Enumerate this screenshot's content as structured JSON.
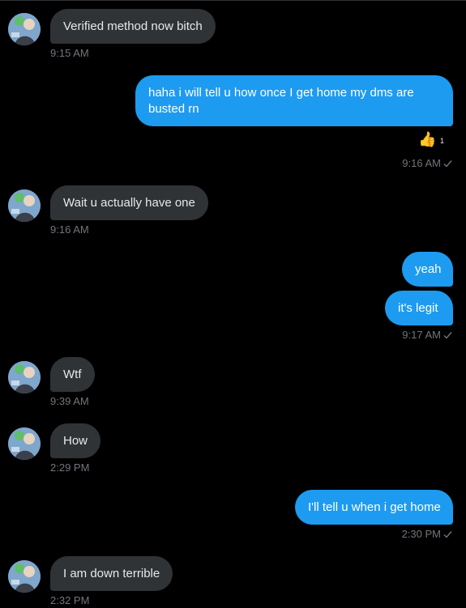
{
  "colors": {
    "background": "#000000",
    "incoming_bubble": "#2f3336",
    "outgoing_bubble": "#1d9bf0",
    "timestamp": "#71767b"
  },
  "messages": [
    {
      "direction": "in",
      "text": "Verified method now bitch",
      "time": "9:15 AM"
    },
    {
      "direction": "out",
      "text": "haha i will tell u how once I get home my dms are busted rn",
      "reaction": "👍",
      "reaction_count": "1",
      "time": "9:16 AM",
      "status_icon": "check-icon"
    },
    {
      "direction": "in",
      "text": "Wait u actually have one",
      "time": "9:16 AM"
    },
    {
      "direction": "out",
      "text": "yeah"
    },
    {
      "direction": "out",
      "text": "it's legit",
      "time": "9:17 AM",
      "status_icon": "check-icon"
    },
    {
      "direction": "in",
      "text": "Wtf",
      "time": "9:39 AM"
    },
    {
      "direction": "in",
      "text": "How",
      "time": "2:29 PM"
    },
    {
      "direction": "out",
      "text": "I'll tell u when i get home",
      "time": "2:30 PM",
      "status_icon": "check-icon"
    },
    {
      "direction": "in",
      "text": "I am down terrible",
      "time": "2:32 PM"
    }
  ]
}
